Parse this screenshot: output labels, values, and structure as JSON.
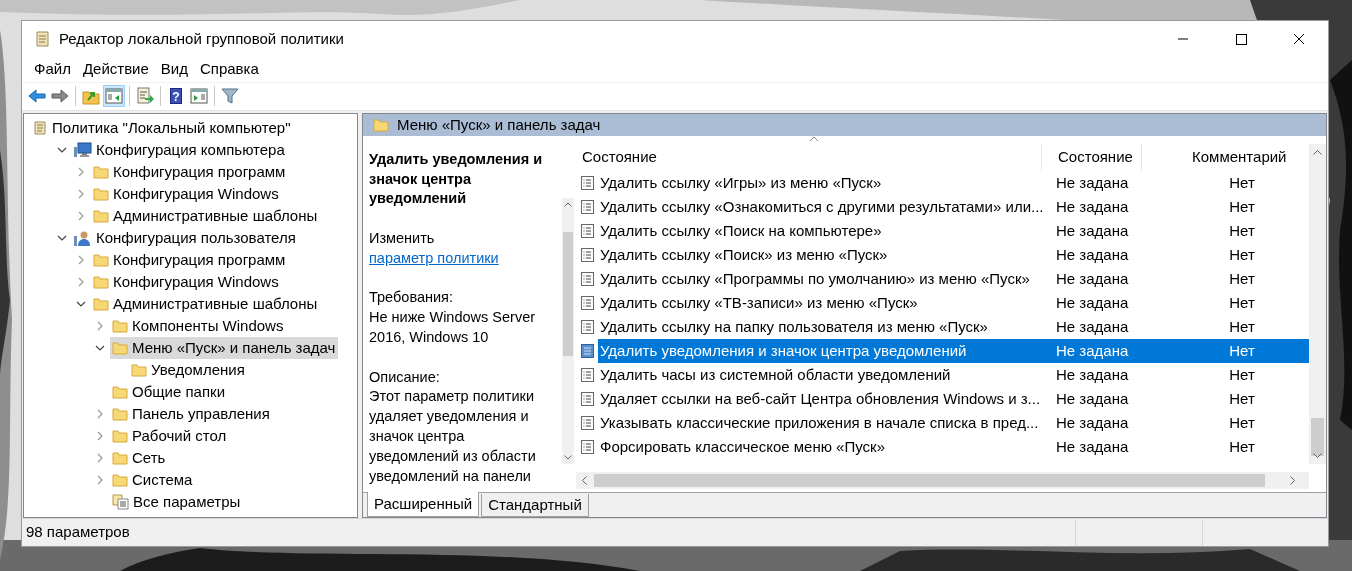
{
  "window": {
    "title": "Редактор локальной групповой политики"
  },
  "menu": [
    "Файл",
    "Действие",
    "Вид",
    "Справка"
  ],
  "toolbar": [
    {
      "kind": "back",
      "pressed": false
    },
    {
      "kind": "forward",
      "pressed": false
    },
    {
      "kind": "separator"
    },
    {
      "kind": "up",
      "pressed": false
    },
    {
      "kind": "tree",
      "pressed": true
    },
    {
      "kind": "separator"
    },
    {
      "kind": "export",
      "pressed": false
    },
    {
      "kind": "separator"
    },
    {
      "kind": "help",
      "pressed": false,
      "glyph": "?"
    },
    {
      "kind": "view",
      "pressed": false
    },
    {
      "kind": "separator"
    },
    {
      "kind": "filter",
      "pressed": false
    }
  ],
  "tree": [
    {
      "label": "Политика \"Локальный компьютер\"",
      "kind": "policy",
      "selected": false,
      "children": [
        {
          "label": "Конфигурация компьютера",
          "kind": "computer",
          "expanded": true,
          "selected": false,
          "children": [
            {
              "label": "Конфигурация программ",
              "kind": "folder",
              "expanded": false,
              "selected": false
            },
            {
              "label": "Конфигурация Windows",
              "kind": "folder",
              "expanded": false,
              "selected": false
            },
            {
              "label": "Административные шаблоны",
              "kind": "folder",
              "expanded": false,
              "selected": false
            }
          ]
        },
        {
          "label": "Конфигурация пользователя",
          "kind": "user",
          "expanded": true,
          "selected": false,
          "children": [
            {
              "label": "Конфигурация программ",
              "kind": "folder",
              "expanded": false,
              "selected": false
            },
            {
              "label": "Конфигурация Windows",
              "kind": "folder",
              "expanded": false,
              "selected": false
            },
            {
              "label": "Административные шаблоны",
              "kind": "folder",
              "expanded": true,
              "selected": false,
              "children": [
                {
                  "label": "Компоненты Windows",
                  "kind": "folder",
                  "expanded": false,
                  "selected": false
                },
                {
                  "label": "Меню «Пуск» и панель задач",
                  "kind": "folder",
                  "expanded": true,
                  "selected": true,
                  "children": [
                    {
                      "label": "Уведомления",
                      "kind": "folder",
                      "selected": false
                    }
                  ]
                },
                {
                  "label": "Общие папки",
                  "kind": "folder",
                  "selected": false
                },
                {
                  "label": "Панель управления",
                  "kind": "folder",
                  "expanded": false,
                  "selected": false
                },
                {
                  "label": "Рабочий стол",
                  "kind": "folder",
                  "expanded": false,
                  "selected": false
                },
                {
                  "label": "Сеть",
                  "kind": "folder",
                  "expanded": false,
                  "selected": false
                },
                {
                  "label": "Система",
                  "kind": "folder",
                  "expanded": false,
                  "selected": false
                },
                {
                  "label": "Все параметры",
                  "kind": "settings",
                  "selected": false
                }
              ]
            }
          ]
        }
      ]
    }
  ],
  "details_header": {
    "title": "Меню «Пуск» и панель задач"
  },
  "description": {
    "title": "Удалить уведомления и значок центра уведомлений",
    "edit_prefix": "Изменить",
    "edit_link": "параметр политики",
    "requirements_label": "Требования:",
    "requirements": "Не ниже Windows Server 2016, Windows 10",
    "description_label": "Описание:",
    "description": "Этот параметр политики удаляет уведомления и значок центра уведомлений из области уведомлений на панели"
  },
  "table": {
    "columns": [
      {
        "label": "Состояние",
        "sorted": true
      },
      {
        "label": "Состояние",
        "sorted": false
      },
      {
        "label": "Комментарий",
        "sorted": false
      }
    ],
    "rows": [
      {
        "name": "Удалить ссылку «Игры» из меню «Пуск»",
        "state": "Не задана",
        "comment": "Нет",
        "selected": false
      },
      {
        "name": "Удалить ссылку «Ознакомиться с другими результатами» или...",
        "state": "Не задана",
        "comment": "Нет",
        "selected": false
      },
      {
        "name": "Удалить ссылку «Поиск на компьютере»",
        "state": "Не задана",
        "comment": "Нет",
        "selected": false
      },
      {
        "name": "Удалить ссылку «Поиск» из меню «Пуск»",
        "state": "Не задана",
        "comment": "Нет",
        "selected": false
      },
      {
        "name": "Удалить ссылку «Программы по умолчанию» из меню «Пуск»",
        "state": "Не задана",
        "comment": "Нет",
        "selected": false
      },
      {
        "name": "Удалить ссылку «ТВ-записи» из меню «Пуск»",
        "state": "Не задана",
        "comment": "Нет",
        "selected": false
      },
      {
        "name": "Удалить ссылку на папку пользователя из меню «Пуск»",
        "state": "Не задана",
        "comment": "Нет",
        "selected": false
      },
      {
        "name": "Удалить уведомления и значок центра уведомлений",
        "state": "Не задана",
        "comment": "Нет",
        "selected": true
      },
      {
        "name": "Удалить часы из системной области уведомлений",
        "state": "Не задана",
        "comment": "Нет",
        "selected": false
      },
      {
        "name": "Удаляет ссылки на веб-сайт Центра обновления Windows и з...",
        "state": "Не задана",
        "comment": "Нет",
        "selected": false
      },
      {
        "name": "Указывать классические приложения в начале списка в пред...",
        "state": "Не задана",
        "comment": "Нет",
        "selected": false
      },
      {
        "name": "Форсировать классическое меню «Пуск»",
        "state": "Не задана",
        "comment": "Нет",
        "selected": false
      }
    ]
  },
  "view_tabs": [
    {
      "label": "Расширенный",
      "selected": true
    },
    {
      "label": "Стандартный",
      "selected": false
    }
  ],
  "status_bar": {
    "text": "98 параметров"
  }
}
